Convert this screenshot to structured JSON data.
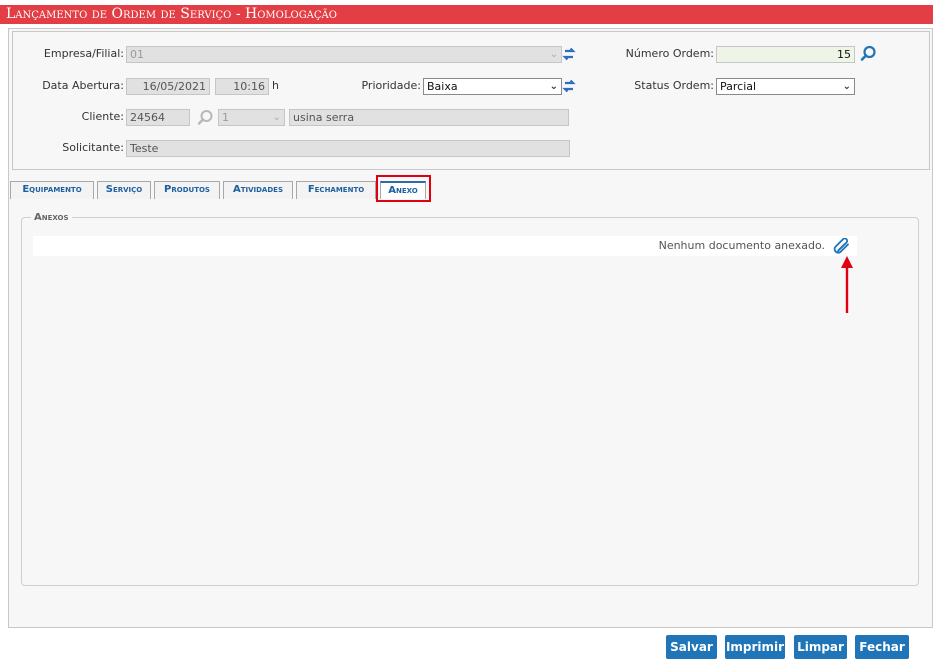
{
  "window": {
    "title": "Lançamento de Ordem de Serviço  - Homologação"
  },
  "form": {
    "empresa": {
      "label": "Empresa/Filial:",
      "value": "01"
    },
    "numero_ordem": {
      "label": "Número Ordem:",
      "value": "15"
    },
    "data_abertura": {
      "label": "Data Abertura:",
      "date": "16/05/2021",
      "time": "10:16",
      "unit": "h"
    },
    "prioridade": {
      "label": "Prioridade:",
      "value": "Baixa"
    },
    "status_ordem": {
      "label": "Status Ordem:",
      "value": "Parcial"
    },
    "cliente": {
      "label": "Cliente:",
      "code": "24564",
      "loja": "1",
      "name": "usina serra"
    },
    "solicitante": {
      "label": "Solicitante:",
      "value": "Teste"
    }
  },
  "tabs": [
    {
      "label": "Equipamento"
    },
    {
      "label": "Serviço"
    },
    {
      "label": "Produtos"
    },
    {
      "label": "Atividades"
    },
    {
      "label": "Fechamento"
    },
    {
      "label": "Anexo",
      "active": true
    }
  ],
  "anexos": {
    "legend": "Anexos",
    "empty_message": "Nenhum documento anexado."
  },
  "buttons": {
    "salvar": "Salvar",
    "imprimir": "Imprimir",
    "limpar": "Limpar",
    "fechar": "Fechar"
  },
  "icons": {
    "refresh": "refresh-icon",
    "search": "search-icon",
    "attach": "paperclip-icon",
    "arrow": "arrow-up-annotation"
  },
  "colors": {
    "title_bar": "#e33d45",
    "accent": "#1f75b7",
    "highlight": "#e00010"
  }
}
